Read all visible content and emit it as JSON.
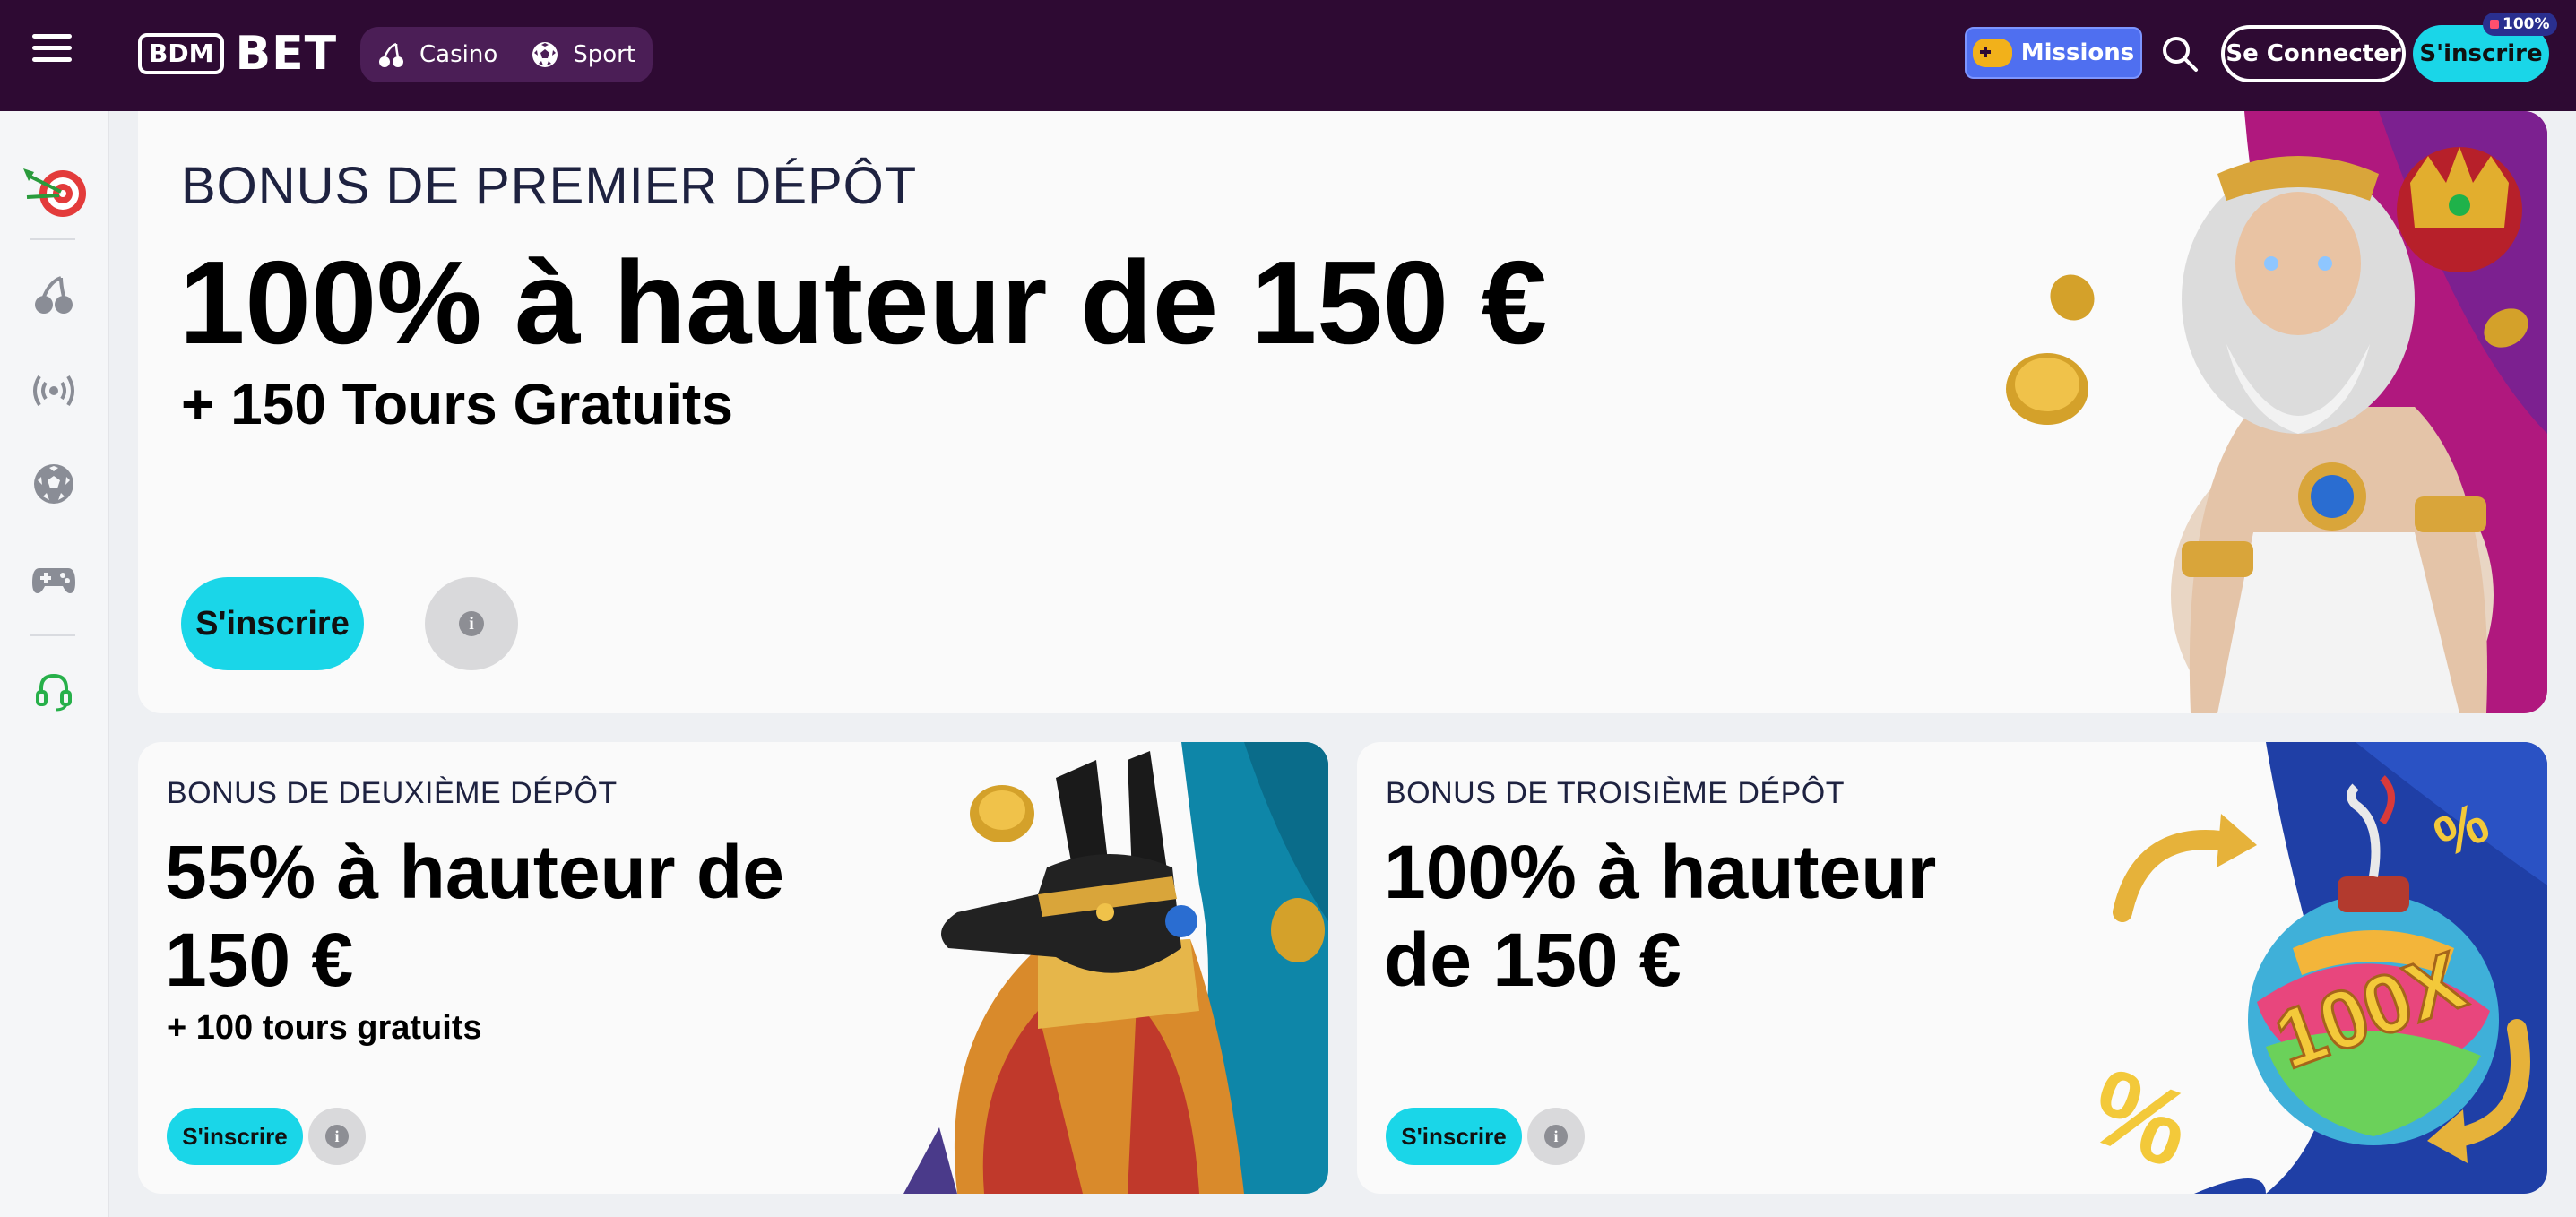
{
  "header": {
    "logo_box": "BDM",
    "logo_text": "BET",
    "nav": [
      {
        "label": "Casino",
        "icon": "cherry-icon"
      },
      {
        "label": "Sport",
        "icon": "soccer-ball-icon"
      }
    ],
    "missions_label": "Missions",
    "login_label": "Se Connecter",
    "signup_label": "S'inscrire",
    "signup_badge": "100%"
  },
  "sidebar": {
    "items": [
      {
        "name": "missions-target",
        "icon": "dart-target-icon"
      },
      {
        "name": "casino",
        "icon": "cherry-icon"
      },
      {
        "name": "live",
        "icon": "broadcast-icon"
      },
      {
        "name": "sport",
        "icon": "soccer-ball-icon"
      },
      {
        "name": "games",
        "icon": "gamepad-icon"
      },
      {
        "name": "support",
        "icon": "headset-icon"
      }
    ]
  },
  "promos": {
    "first": {
      "kicker": "BONUS DE PREMIER DÉPÔT",
      "headline": "100% à hauteur de 150 €",
      "sub": "+ 150 Tours Gratuits",
      "cta": "S'inscrire",
      "info": "i"
    },
    "second": {
      "kicker": "BONUS DE DEUXIÈME DÉPÔT",
      "headline": "55% à hauteur de 150 €",
      "sub": "+ 100 tours gratuits",
      "cta": "S'inscrire",
      "info": "i"
    },
    "third": {
      "kicker": "BONUS DE TROISIÈME DÉPÔT",
      "headline": "100% à hauteur de 150 €",
      "cta": "S'inscrire",
      "info": "i",
      "art_label": "100X"
    }
  },
  "colors": {
    "header_bg": "#2e0a33",
    "accent_cyan": "#1ad6e8",
    "missions_blue": "#4f6ff0",
    "zeus_bg": "#b0187e",
    "anubis_bg": "#0e86a8",
    "bomb_bg": "#1f3fa6"
  }
}
